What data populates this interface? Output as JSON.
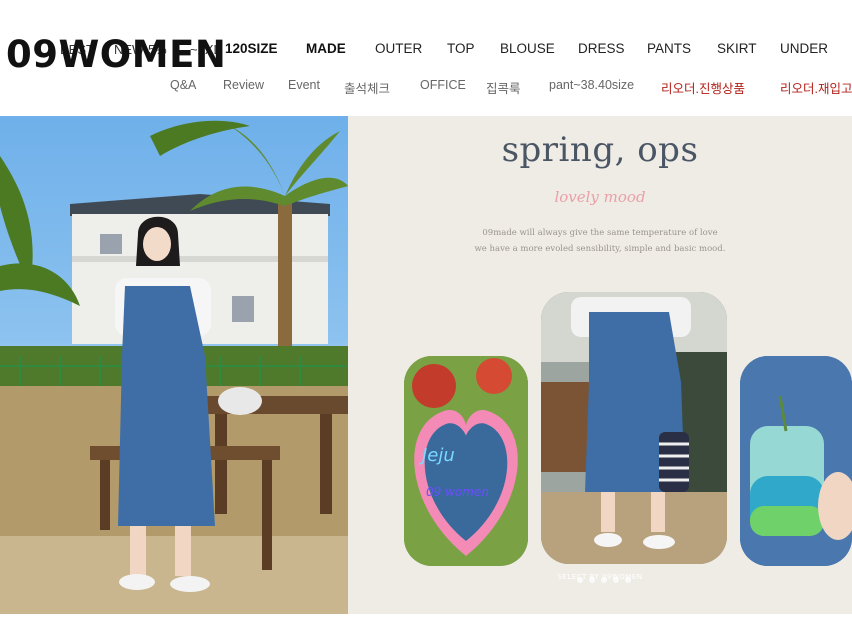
{
  "brand": {
    "logo_text": "09WOMEN"
  },
  "nav": {
    "ghost_items": [
      "BEST",
      "NEW 5%",
      "~2XL"
    ],
    "primary": [
      "120SIZE",
      "MADE",
      "OUTER",
      "TOP",
      "BLOUSE",
      "DRESS",
      "PANTS",
      "SKIRT",
      "UNDER"
    ],
    "secondary": [
      "Q&A",
      "Review",
      "Event",
      "출석체크",
      "OFFICE",
      "집콕룩",
      "pant~38.40size",
      "리오더.진행상품",
      "리오더.재입고"
    ]
  },
  "banner": {
    "title": "spring, ops",
    "subtitle": "lovely mood",
    "tagline_1": "09made will always give the same temperature of love",
    "tagline_2": "we have a more evoled sensibility, simple and basic mood.",
    "credit": "SELECT BY 09WOMEN",
    "mirror_text_1": "Jeju",
    "mirror_text_2": "09 women"
  },
  "colors": {
    "accent_red": "#b32019",
    "title_gray": "#4b5665",
    "sub_pink": "#e9a0a8"
  }
}
